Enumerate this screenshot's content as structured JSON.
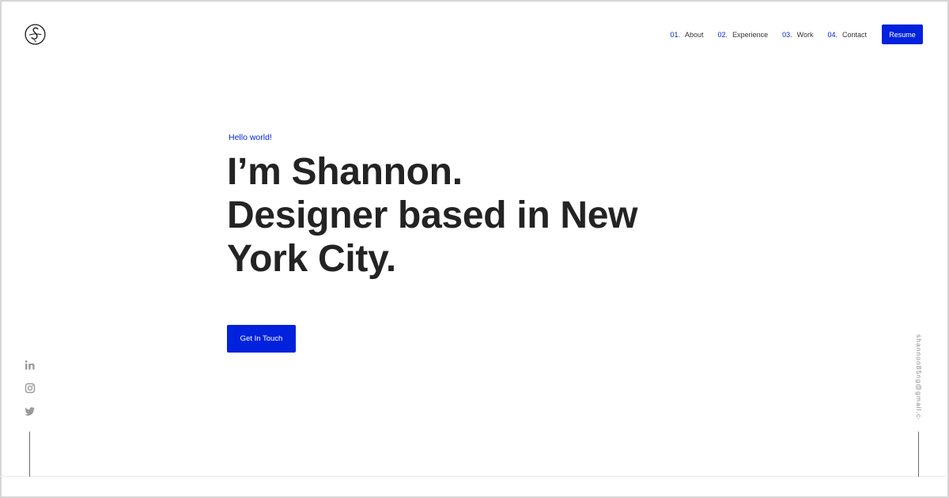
{
  "logo": {
    "icon": "signature-s-logo-icon"
  },
  "nav": {
    "items": [
      {
        "num": "01.",
        "label": "About"
      },
      {
        "num": "02.",
        "label": "Experience"
      },
      {
        "num": "03.",
        "label": "Work"
      },
      {
        "num": "04.",
        "label": "Contact"
      }
    ],
    "resume_label": "Resume"
  },
  "hero": {
    "greeting": "Hello world!",
    "title_lines": [
      "I’m Shannon.",
      "Designer based in New",
      "York City."
    ],
    "cta_label": "Get In Touch"
  },
  "socials": [
    {
      "icon": "linkedin-icon"
    },
    {
      "icon": "instagram-icon"
    },
    {
      "icon": "twitter-icon"
    }
  ],
  "email": "shannon85ng@gmail.com",
  "colors": {
    "accent": "#0022dd",
    "text": "#232323",
    "muted": "#8a8a8a"
  }
}
